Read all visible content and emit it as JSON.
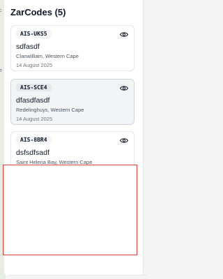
{
  "panel": {
    "title": "ZarCodes (5)"
  },
  "codes": [
    {
      "code": "AIS-UKS5",
      "name": "sdfasdf",
      "location": "Clanwilliam, Western Cape",
      "date": "14 August 2025",
      "selected": false
    },
    {
      "code": "AIS-SCE4",
      "name": "dfasdfasdf",
      "location": "Redelinghuys, Western Cape",
      "date": "14 August 2025",
      "selected": true
    },
    {
      "code": "AIS-8BR4",
      "name": "dsfsdfsadf",
      "location": "Saint Helena Bay, Western Cape",
      "date": "",
      "selected": false
    }
  ],
  "map": {
    "labels": [
      "c",
      "e"
    ]
  },
  "icons": {
    "view": "eye-icon"
  },
  "colors": {
    "highlight": "#e0463c",
    "selected_bg": "#f3f4f6"
  }
}
